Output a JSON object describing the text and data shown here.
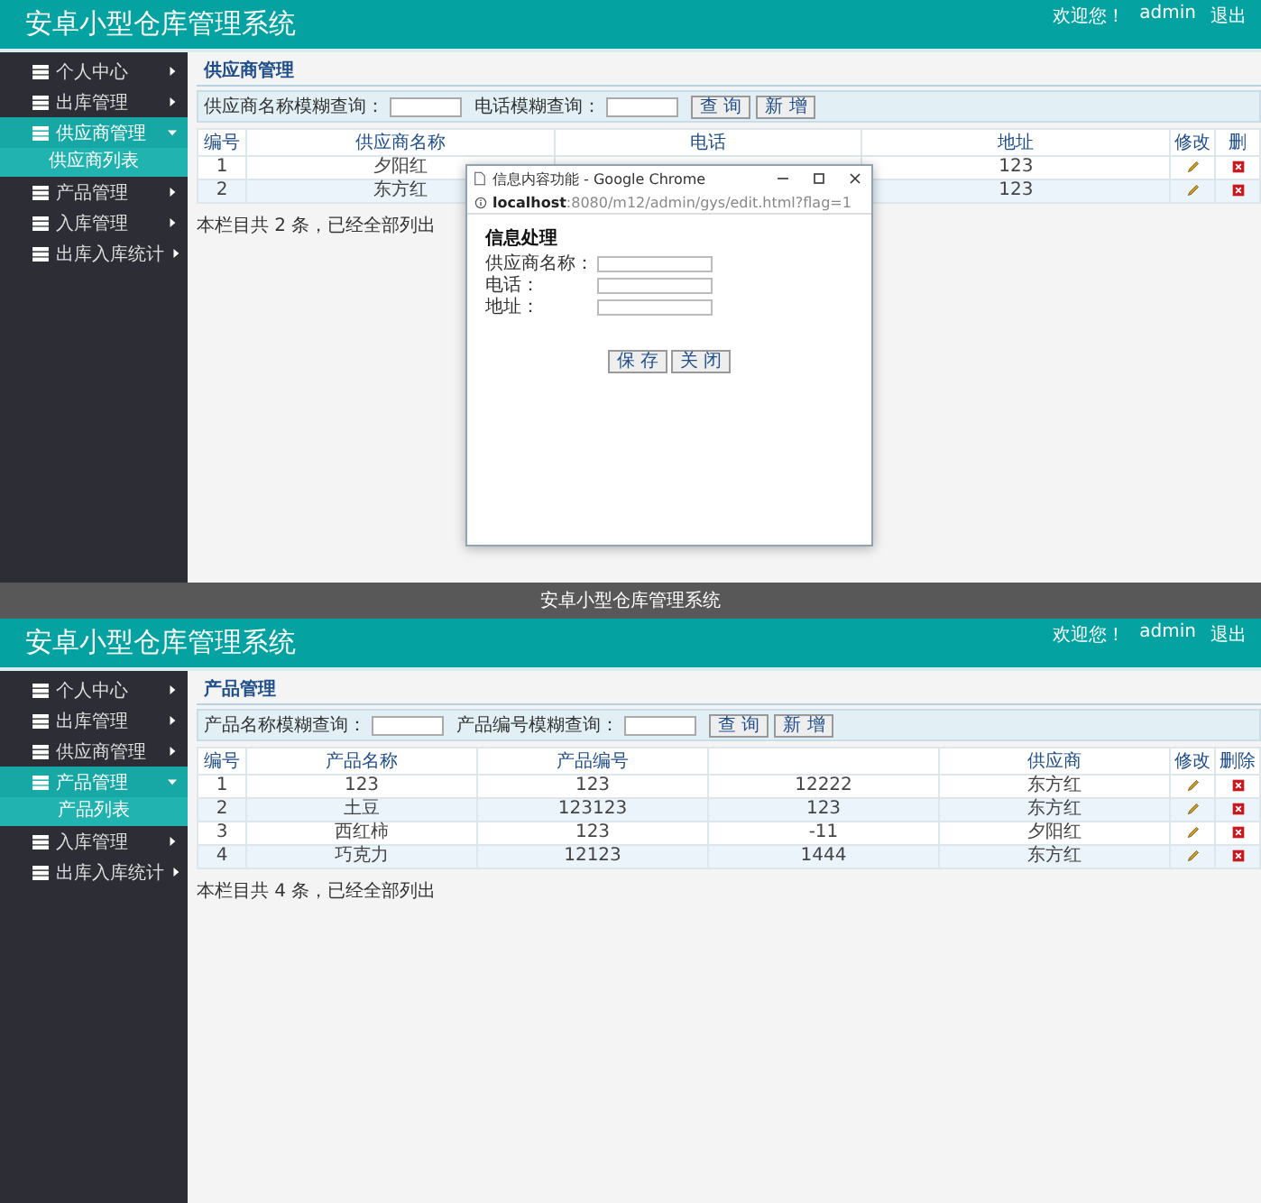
{
  "screens": [
    {
      "header": {
        "title": "安卓小型仓库管理系统",
        "welcome": "欢迎您！",
        "user": "admin",
        "logout": "退出"
      },
      "sidebar": [
        {
          "label": "个人中心",
          "expanded": false,
          "selected": false
        },
        {
          "label": "出库管理",
          "expanded": false,
          "selected": false
        },
        {
          "label": "供应商管理",
          "expanded": true,
          "selected": true,
          "children": [
            {
              "label": "供应商列表",
              "selected": true
            }
          ]
        },
        {
          "label": "产品管理",
          "expanded": false,
          "selected": false
        },
        {
          "label": "入库管理",
          "expanded": false,
          "selected": false
        },
        {
          "label": "出库入库统计",
          "expanded": false,
          "selected": false
        }
      ],
      "content": {
        "title": "供应商管理",
        "search": [
          {
            "label": "供应商名称模糊查询："
          },
          {
            "label": "电话模糊查询："
          }
        ],
        "buttons": [
          "查 询",
          "新 增"
        ],
        "columns": [
          "编号",
          "供应商名称",
          "电话",
          "地址",
          "修改",
          "删"
        ],
        "rows": [
          {
            "cells": [
              "1",
              "夕阳红",
              null,
              "123"
            ]
          },
          {
            "cells": [
              "2",
              "东方红",
              null,
              "123"
            ]
          }
        ],
        "summary": "本栏目共 2 条，已经全部列出"
      },
      "popup": {
        "title": "信息内容功能 - Google Chrome",
        "url_host": "localhost",
        "url_path": ":8080/m12/admin/gys/edit.html?flag=1",
        "heading": "信息处理",
        "fields": [
          {
            "label": "供应商名称："
          },
          {
            "label": "电话："
          },
          {
            "label": "地址："
          }
        ],
        "buttons": [
          "保 存",
          "关 闭"
        ]
      },
      "footer": "安卓小型仓库管理系统"
    },
    {
      "header": {
        "title": "安卓小型仓库管理系统",
        "welcome": "欢迎您！",
        "user": "admin",
        "logout": "退出"
      },
      "sidebar": [
        {
          "label": "个人中心",
          "expanded": false,
          "selected": false
        },
        {
          "label": "出库管理",
          "expanded": false,
          "selected": false
        },
        {
          "label": "供应商管理",
          "expanded": false,
          "selected": false
        },
        {
          "label": "产品管理",
          "expanded": true,
          "selected": true,
          "children": [
            {
              "label": "产品列表",
              "selected": true
            }
          ]
        },
        {
          "label": "入库管理",
          "expanded": false,
          "selected": false
        },
        {
          "label": "出库入库统计",
          "expanded": false,
          "selected": false
        }
      ],
      "content": {
        "title": "产品管理",
        "search": [
          {
            "label": "产品名称模糊查询："
          },
          {
            "label": "产品编号模糊查询："
          }
        ],
        "buttons": [
          "查 询",
          "新 增"
        ],
        "columns": [
          "编号",
          "产品名称",
          "产品编号",
          null,
          "供应商",
          "修改",
          "删除"
        ],
        "rows": [
          {
            "cells": [
              "1",
              "123",
              "123",
              "12222",
              "东方红"
            ]
          },
          {
            "cells": [
              "2",
              "土豆",
              "123123",
              "123",
              "东方红"
            ]
          },
          {
            "cells": [
              "3",
              "西红柿",
              "123",
              "-11",
              "夕阳红"
            ]
          },
          {
            "cells": [
              "4",
              "巧克力",
              "12123",
              "1444",
              "东方红"
            ]
          }
        ],
        "summary": "本栏目共 4 条，已经全部列出"
      }
    }
  ]
}
